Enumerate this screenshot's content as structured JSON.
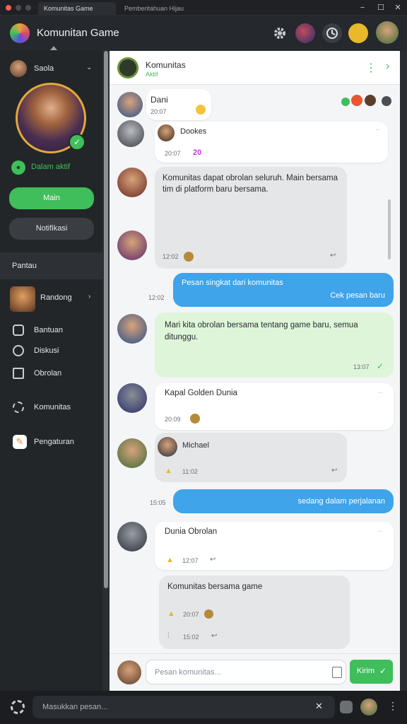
{
  "window": {
    "tab_active": "Komunitas Game",
    "tab_inactive": "Pemberitahuan Hijau",
    "min_icon": "−",
    "max_icon": "☐",
    "close_icon": "✕"
  },
  "header": {
    "title": "Komunitan Game"
  },
  "sidebar": {
    "user_name": "Saola",
    "status_label": "Dalam aktif",
    "primary_button": "Main",
    "secondary_button": "Notifikasi",
    "section_label": "Pantau",
    "group_name": "Randong",
    "items": [
      {
        "label": "Bantuan"
      },
      {
        "label": "Diskusi"
      },
      {
        "label": "Obrolan"
      },
      {
        "label": "Komunitas"
      },
      {
        "label": "Pengaturan"
      }
    ]
  },
  "chat": {
    "room_title": "Komunitas",
    "room_subtitle": "Aktif",
    "top_message": {
      "name": "Dani",
      "time": "20:07"
    },
    "messages": [
      {
        "name": "Dookes",
        "time": "20:07",
        "badge": "20"
      },
      {
        "text": "Komunitas dapat obrolan seluruh. Main bersama tim di platform baru bersama.",
        "time": "12:02"
      },
      {
        "text_line1": "Pesan singkat dari komunitas",
        "text_line2": "Cek pesan baru",
        "time": "12:02"
      },
      {
        "text": "Mari kita obrolan bersama tentang game baru, semua ditunggu.",
        "time": "13:07"
      },
      {
        "name": "Kapal Golden Dunia",
        "time": "20:09"
      },
      {
        "name": "Michael",
        "time": "11:02"
      },
      {
        "text": "sedang dalam perjalanan",
        "time": "15:05"
      },
      {
        "name": "Dunia Obrolan",
        "time": "12:07"
      },
      {
        "text": "Komunitas bersama game",
        "time": "20:07",
        "time2": "15:02"
      }
    ],
    "input_placeholder": "Pesan komunitas...",
    "send_label": "Kirim"
  },
  "footer": {
    "search_placeholder": "Masukkan pesan..."
  },
  "colors": {
    "accent_green": "#3fbe5b",
    "accent_blue": "#3fa4ea",
    "sidebar_bg": "#232629",
    "chat_bg": "#f4f5f6"
  }
}
